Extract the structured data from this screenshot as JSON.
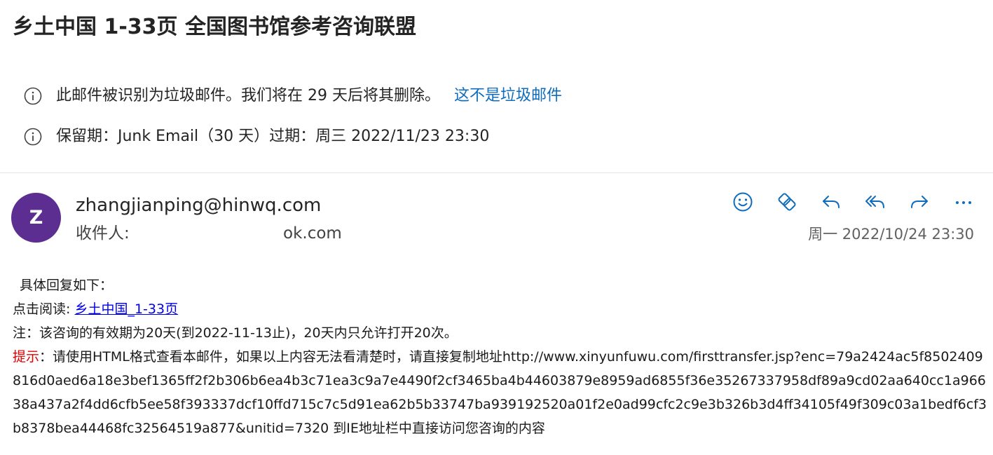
{
  "subject": "乡土中国 1-33页 全国图书馆参考咨询联盟",
  "notices": {
    "junk": {
      "text": "此邮件被识别为垃圾邮件。我们将在 29 天后将其删除。",
      "link": "这不是垃圾邮件"
    },
    "retention": {
      "text": "保留期：Junk Email（30 天）过期：周三 2022/11/23 23:30"
    }
  },
  "message": {
    "avatar_initial": "Z",
    "sender": "zhangjianping@hinwq.com",
    "recipient_label": "收件人:",
    "recipient_value": "ok.com",
    "datetime": "周一 2022/10/24 23:30",
    "actions": [
      "smiley-icon",
      "forward-to-teams-icon",
      "reply-icon",
      "reply-all-icon",
      "forward-icon",
      "more-icon"
    ]
  },
  "body": {
    "line1": "具体回复如下：",
    "read_label": "点击阅读: ",
    "read_link": "乡土中国_1-33页",
    "note": "注：该咨询的有效期为20天(到2022-11-13止)，20天内只允许打开20次。",
    "hint_label": "提示",
    "hint_text": "：请使用HTML格式查看本邮件，如果以上内容无法看清楚时，请直接复制地址http://www.xinyunfuwu.com/firsttransfer.jsp?enc=79a2424ac5f8502409816d0aed6a18e3bef1365ff2f2b306b6ea4b3c71ea3c9a7e4490f2cf3465ba4b44603879e8959ad6855f36e35267337958df89a9cd02aa640cc1a96638a437a2f4dd6cfb5ee58f393337dcf10ffd715c7c5d91ea62b5b33747ba939192520a01f2e0ad99cfc2c9e3b326b3d4ff34105f49f309c03a1bedf6cf3b8378bea44468fc32564519a877&unitid=7320 到IE地址栏中直接访问您咨询的内容"
  },
  "colors": {
    "accent": "#0f6cbd",
    "avatar": "#5c2e91",
    "hint": "#e00000",
    "link": "#0000ee"
  }
}
